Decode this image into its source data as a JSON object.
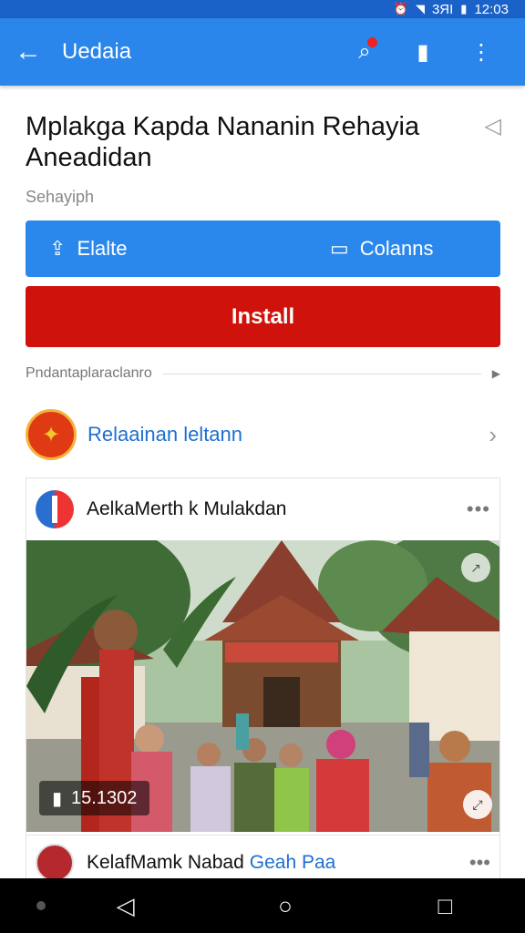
{
  "status_bar": {
    "time": "12:03",
    "signal_text": "3ЯI"
  },
  "app_bar": {
    "title": "Uedaia",
    "back_icon": "arrow-left-icon",
    "actions": [
      "search-icon",
      "bookmark-icon",
      "more-vertical-icon"
    ]
  },
  "article": {
    "title": "Mplakga Kapda Nananin Rehayia Aneadidan",
    "subtitle": "Sehayiph",
    "share_icon": "share-triangle-icon"
  },
  "actions": {
    "left_label": "Elalte",
    "right_label": "Colanns",
    "install_label": "Install"
  },
  "section": {
    "label": "Pndantaplaraclanro"
  },
  "publisher": {
    "name": "Relaainan leltann"
  },
  "post": {
    "title": "AelkaMerth k Mulakdan",
    "more": "•••",
    "view_count": "15.1302"
  },
  "post2": {
    "title": "KelafMamk Nabad",
    "tag": "Geah Paa",
    "more": "•••"
  },
  "colors": {
    "appbar": "#2a86ea",
    "install": "#d0120c",
    "link": "#1e6fd0"
  }
}
